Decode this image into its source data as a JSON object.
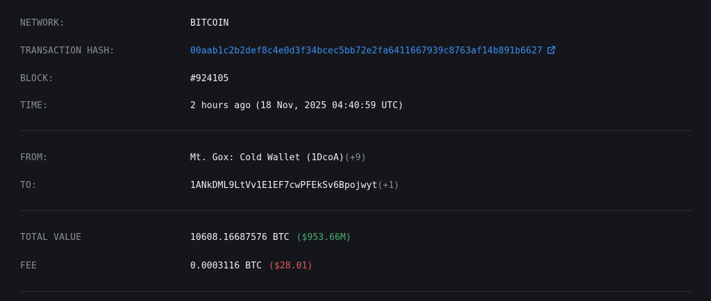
{
  "transaction": {
    "network": {
      "label": "NETWORK:",
      "value": "BITCOIN"
    },
    "hash": {
      "label": "TRANSACTION HASH:",
      "value": "00aab1c2b2def8c4e0d3f34bcec5bb72e2fa6411667939c8763af14b891b6627",
      "icon": "external-link-icon"
    },
    "block": {
      "label": "BLOCK:",
      "value": "#924105"
    },
    "time": {
      "label": "TIME:",
      "relative": "2 hours ago",
      "absolute": "(18 Nov, 2025 04:40:59 UTC)"
    }
  },
  "parties": {
    "from": {
      "label": "FROM:",
      "value": "Mt. Gox: Cold Wallet (1DcoA)",
      "extra": "(+9)"
    },
    "to": {
      "label": "TO:",
      "value": "1ANkDML9LtVv1E1EF7cwPFEkSv6Bpojwyt",
      "extra": "(+1)"
    }
  },
  "amounts": {
    "total": {
      "label": "TOTAL VALUE",
      "value": "10608.16687576 BTC",
      "usd": "($953.66M)"
    },
    "fee": {
      "label": "FEE",
      "value": "0.0003116 BTC",
      "usd": "($28.01)"
    }
  },
  "colors": {
    "background": "#15161c",
    "label": "#8b8e98",
    "link": "#3d8ef0",
    "positive": "#4caf72",
    "negative": "#e05a55"
  }
}
